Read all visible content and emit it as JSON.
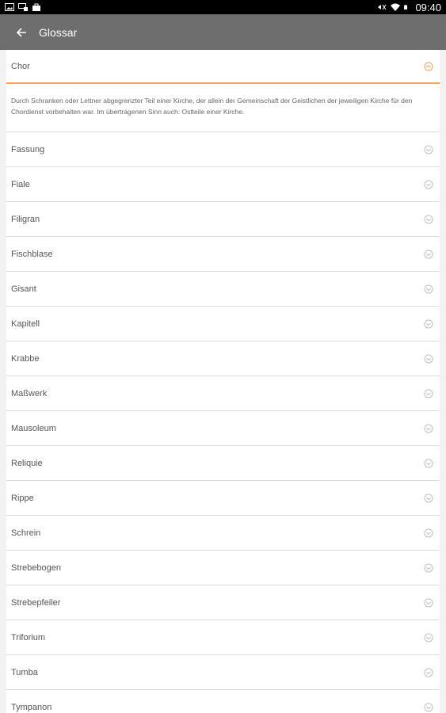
{
  "status_bar": {
    "time": "09:40",
    "left_icons": [
      "image-icon",
      "cast-icon",
      "bag-icon"
    ],
    "right_icons": [
      "mute-icon",
      "wifi-icon",
      "battery-icon"
    ]
  },
  "app_bar": {
    "title": "Glossar"
  },
  "colors": {
    "accent": "#f2a060",
    "appbar": "#6e6e6e"
  },
  "glossary": {
    "expanded": {
      "term": "Chor",
      "definition": "Durch Schranken oder Lettner abgegrenzter Teil einer Kirche, der allein der Gemeinschaft der Geistlichen der jeweiligen Kirche für den Chordienst vorbehalten war. Im übertragenen Sinn auch: Ostteile einer Kirche."
    },
    "items": [
      {
        "term": "Fassung"
      },
      {
        "term": "Fiale"
      },
      {
        "term": "Filigran"
      },
      {
        "term": "Fischblase"
      },
      {
        "term": "Gisant"
      },
      {
        "term": "Kapitell"
      },
      {
        "term": "Krabbe"
      },
      {
        "term": "Maßwerk"
      },
      {
        "term": "Mausoleum"
      },
      {
        "term": "Reliquie"
      },
      {
        "term": "Rippe"
      },
      {
        "term": "Schrein"
      },
      {
        "term": "Strebebogen"
      },
      {
        "term": "Strebepfeiler"
      },
      {
        "term": "Triforium"
      },
      {
        "term": "Tumba"
      },
      {
        "term": "Tympanon"
      }
    ]
  }
}
